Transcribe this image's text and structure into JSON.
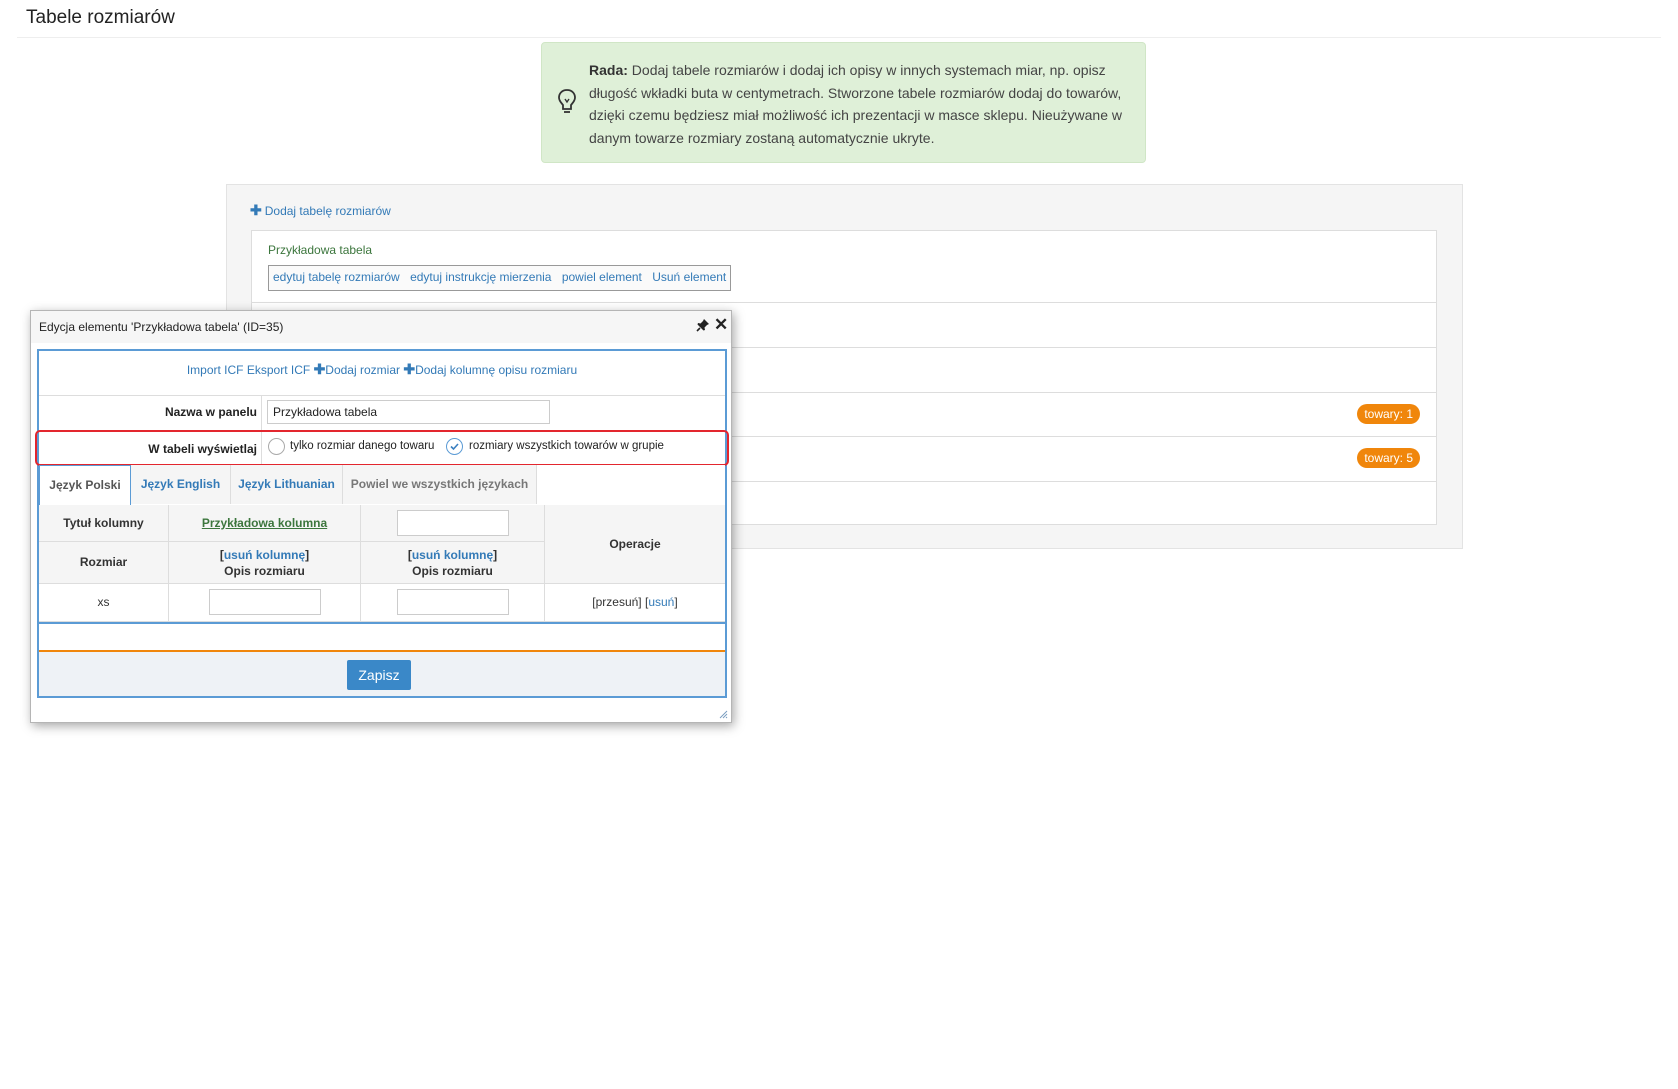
{
  "page": {
    "title": "Tabele rozmiarów"
  },
  "tip": {
    "label": "Rada:",
    "text": "Dodaj tabele rozmiarów i dodaj ich opisy w innych systemach miar, np. opisz długość wkładki buta w centymetrach. Stworzone tabele rozmiarów dodaj do towarów, dzięki czemu będziesz miał możliwość ich prezentacji w masce sklepu. Nieużywane w danym towarze rozmiary zostaną automatycznie ukryte."
  },
  "list": {
    "add_link": "Dodaj tabelę rozmiarów",
    "first_item": {
      "name": "Przykładowa tabela",
      "actions": [
        "edytuj tabelę rozmiarów",
        "edytuj instrukcję mierzenia",
        "powiel element",
        "Usuń element"
      ]
    },
    "badges": [
      "towary: 1",
      "towary: 5"
    ]
  },
  "dialog": {
    "title": "Edycja elementu 'Przykładowa tabela' (ID=35)",
    "toolbar": {
      "import": "Import ICF",
      "export": "Eksport ICF",
      "add_size": "Dodaj rozmiar",
      "add_column": "Dodaj kolumnę opisu rozmiaru"
    },
    "name_label": "Nazwa w panelu",
    "name_value": "Przykładowa tabela",
    "display_label": "W tabeli wyświetlaj",
    "display_options": [
      "tylko rozmiar danego towaru",
      "rozmiary wszystkich towarów w grupie"
    ],
    "display_selected": "rozmiary wszystkich towarów w grupie",
    "tabs": [
      "Język Polski",
      "Język English",
      "Język Lithuanian",
      "Powiel we wszystkich językach"
    ],
    "active_tab": "Język Polski",
    "table": {
      "col_title_label": "Tytuł kolumny",
      "column_1_title": "Przykładowa kolumna",
      "size_label": "Rozmiar",
      "remove_column_open": "[",
      "remove_column": "usuń kolumnę",
      "remove_column_close": "]",
      "desc_label": "Opis rozmiaru",
      "operations_label": "Operacje",
      "rows": [
        {
          "size": "xs",
          "move": "[przesuń]",
          "delete_open": "[",
          "delete": "usuń",
          "delete_close": "]"
        }
      ]
    },
    "save_label": "Zapisz"
  }
}
